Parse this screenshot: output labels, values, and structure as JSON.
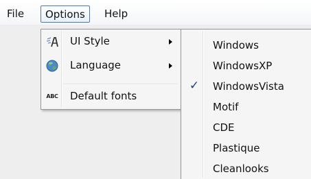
{
  "menubar": {
    "items": [
      {
        "label": "File"
      },
      {
        "label": "Options",
        "active": true
      },
      {
        "label": "Help"
      }
    ]
  },
  "options_menu": {
    "items": [
      {
        "label": "UI Style",
        "icon": "font-style-icon",
        "submenu": true
      },
      {
        "label": "Language",
        "icon": "globe-icon",
        "submenu": true
      },
      {
        "label": "Default fonts",
        "icon": "abc-icon",
        "icon_text": "ABC",
        "submenu": false
      }
    ]
  },
  "ui_style_menu": {
    "selected": "WindowsVista",
    "items": [
      {
        "label": "Windows"
      },
      {
        "label": "WindowsXP"
      },
      {
        "label": "WindowsVista",
        "checked": true
      },
      {
        "label": "Motif"
      },
      {
        "label": "CDE"
      },
      {
        "label": "Plastique"
      },
      {
        "label": "Cleanlooks"
      }
    ],
    "check_glyph": "✓"
  },
  "colors": {
    "window_bg": "#eeeeee",
    "menu_bg": "#f5f5f5",
    "menu_border": "#979797",
    "check": "#1b3f95"
  }
}
